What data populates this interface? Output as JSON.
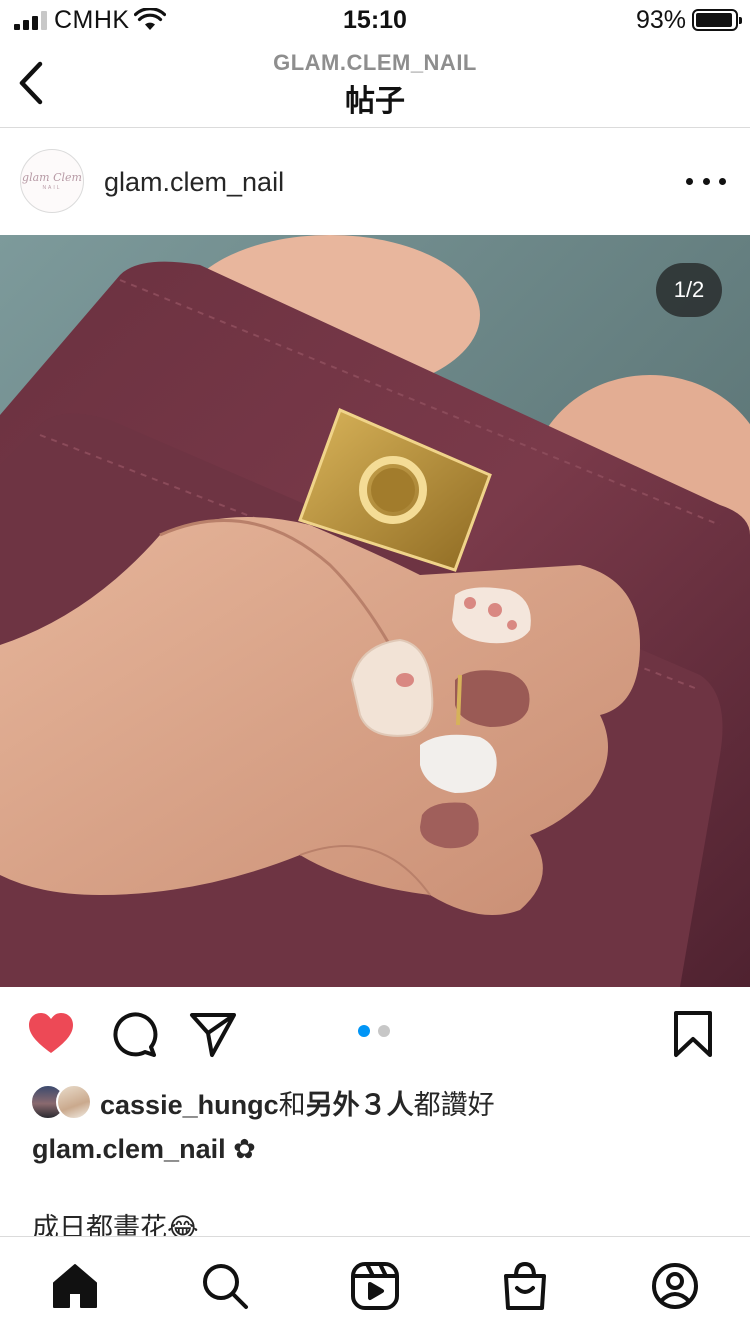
{
  "status_bar": {
    "carrier": "CMHK",
    "time": "15:10",
    "battery_percent": "93%",
    "battery_level": 0.93,
    "signal_bars": 3
  },
  "nav": {
    "subtitle": "GLAM.CLEM_NAIL",
    "title": "帖子",
    "back_icon": "chevron-left-icon"
  },
  "post": {
    "avatar_text_1": "glam Clem",
    "avatar_text_2": "NAIL",
    "username": "glam.clem_nail",
    "more_icon": "more-horizontal-icon",
    "image_counter": "1/2",
    "current_image": 1,
    "total_images": 2
  },
  "actions": {
    "like_icon": "heart-filled-icon",
    "comment_icon": "comment-icon",
    "share_icon": "send-icon",
    "save_icon": "bookmark-icon",
    "like_color": "#ed4956",
    "dot_active_color": "#0095f6"
  },
  "likes": {
    "liker": "cassie_hungc",
    "connector": "和",
    "others": "另外３人",
    "suffix": "都讚好"
  },
  "caption": {
    "username": "glam.clem_nail",
    "flower": "✿",
    "text": "成日都畫花😂"
  },
  "tab_bar": {
    "items": [
      "home-icon",
      "search-icon",
      "reels-icon",
      "shop-icon",
      "profile-icon"
    ]
  }
}
